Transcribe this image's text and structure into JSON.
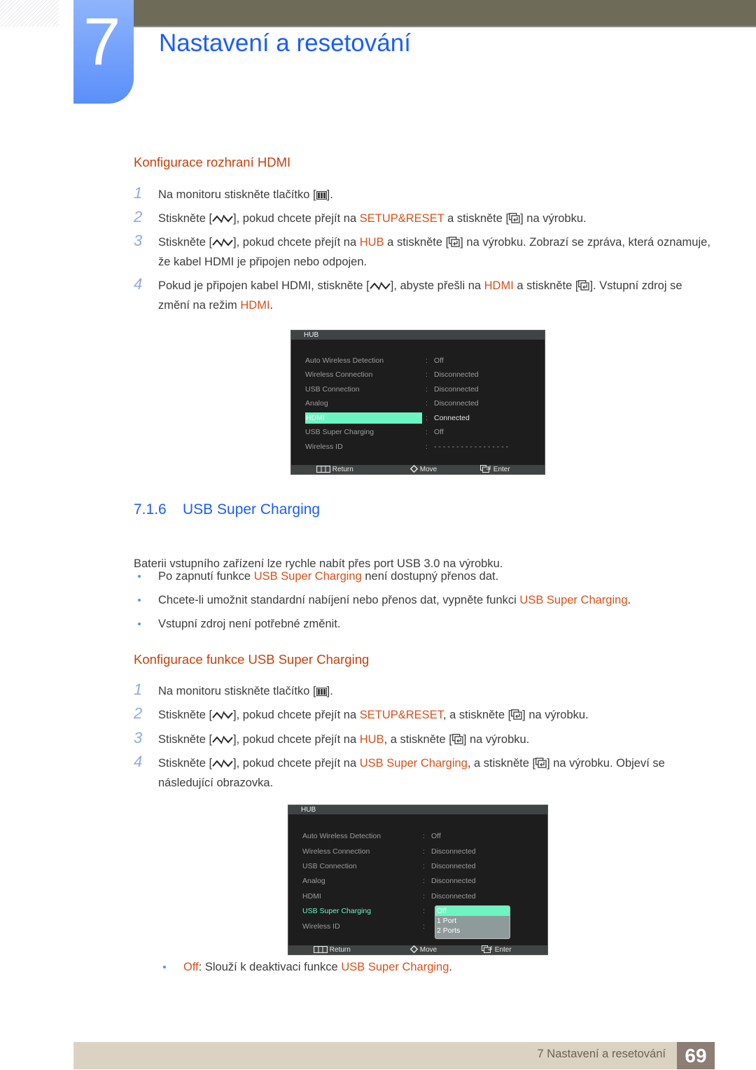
{
  "header": {
    "chapter_number": "7",
    "chapter_title": "Nastavení a resetování"
  },
  "section_hdmi": {
    "heading": "Konfigurace rozhraní HDMI",
    "steps": [
      {
        "n": "1",
        "parts": [
          "Na monitoru stiskněte tlačítko [",
          "menu-icon",
          "]."
        ]
      },
      {
        "n": "2",
        "parts": [
          "Stiskněte [",
          "up-down-icon",
          "], pokud chcete přejít na ",
          "hl:SETUP&RESET",
          " a stiskněte [",
          "enter-icon",
          "] na výrobku."
        ]
      },
      {
        "n": "3",
        "parts": [
          "Stiskněte [",
          "up-down-icon",
          "], pokud chcete přejít na ",
          "hl:HUB",
          " a stiskněte [",
          "enter-icon",
          "] na výrobku. Zobrazí se zpráva, která oznamuje, že kabel HDMI je připojen nebo odpojen."
        ]
      },
      {
        "n": "4",
        "parts": [
          "Pokud je připojen kabel HDMI, stiskněte [",
          "up-down-icon",
          "], abyste přešli na ",
          "hl:HDMI",
          " a stiskněte [",
          "enter-icon",
          "]. Vstupní zdroj se změní na režim ",
          "hl:HDMI",
          "."
        ]
      }
    ]
  },
  "osd1": {
    "title": "HUB",
    "rows": [
      {
        "label": "Auto Wireless Detection",
        "value": "Off",
        "state": "normal"
      },
      {
        "label": "Wireless Connection",
        "value": "Disconnected",
        "state": "normal"
      },
      {
        "label": "USB Connection",
        "value": "Disconnected",
        "state": "normal"
      },
      {
        "label": "Analog",
        "value": "Disconnected",
        "state": "normal"
      },
      {
        "label": "HDMI",
        "value": "Connected",
        "state": "selected"
      },
      {
        "label": "USB Super Charging",
        "value": "Off",
        "state": "normal"
      },
      {
        "label": "Wireless ID",
        "value": "- - - - - - - - - - - - - - - - -",
        "state": "normal"
      }
    ],
    "footer": {
      "return": "Return",
      "move": "Move",
      "enter": "Enter"
    }
  },
  "section_usb": {
    "number": "7.1.6",
    "title": "USB Super Charging",
    "intro": "Baterii vstupního zařízení lze rychle nabít přes port USB 3.0 na výrobku.",
    "bullets": [
      {
        "parts": [
          "Po zapnutí funkce ",
          "hl:USB Super Charging",
          " není dostupný přenos dat."
        ]
      },
      {
        "parts": [
          "Chcete-li umožnit standardní nabíjení nebo přenos dat, vypněte funkci ",
          "hl:USB Super Charging",
          "."
        ]
      },
      {
        "parts": [
          "Vstupní zdroj není potřebné změnit."
        ]
      }
    ]
  },
  "section_usb_config": {
    "heading": "Konfigurace funkce USB Super Charging",
    "steps": [
      {
        "n": "1",
        "parts": [
          "Na monitoru stiskněte tlačítko [",
          "menu-icon",
          "]."
        ]
      },
      {
        "n": "2",
        "parts": [
          "Stiskněte [",
          "up-down-icon",
          "], pokud chcete přejít na ",
          "hl:SETUP&RESET",
          ", a stiskněte [",
          "enter-icon",
          "] na výrobku."
        ]
      },
      {
        "n": "3",
        "parts": [
          "Stiskněte [",
          "up-down-icon",
          "], pokud chcete přejít na ",
          "hl:HUB",
          ", a stiskněte [",
          "enter-icon",
          "] na výrobku."
        ]
      },
      {
        "n": "4",
        "parts": [
          "Stiskněte [",
          "up-down-icon",
          "], pokud chcete přejít na ",
          "hl:USB Super Charging",
          ", a stiskněte [",
          "enter-icon",
          "] na výrobku. Objeví se následující obrazovka."
        ]
      }
    ]
  },
  "osd2": {
    "title": "HUB",
    "rows": [
      {
        "label": "Auto Wireless Detection",
        "value": "Off",
        "state": "normal"
      },
      {
        "label": "Wireless Connection",
        "value": "Disconnected",
        "state": "normal"
      },
      {
        "label": "USB Connection",
        "value": "Disconnected",
        "state": "normal"
      },
      {
        "label": "Analog",
        "value": "Disconnected",
        "state": "normal"
      },
      {
        "label": "HDMI",
        "value": "Disconnected",
        "state": "normal"
      },
      {
        "label": "USB Super Charging",
        "value": "",
        "state": "active"
      },
      {
        "label": "Wireless ID",
        "value": "",
        "state": "normal"
      }
    ],
    "dropdown": {
      "options": [
        "Off",
        "1 Port",
        "2 Ports"
      ],
      "selected": "Off"
    },
    "footer": {
      "return": "Return",
      "move": "Move",
      "enter": "Enter"
    }
  },
  "option_notes": [
    {
      "parts": [
        "hl:Off",
        ": Slouží k deaktivaci funkce ",
        "hl:USB Super Charging",
        "."
      ]
    }
  ],
  "footer": {
    "chapter_label": "7 Nastavení a resetování",
    "page_number": "69"
  }
}
